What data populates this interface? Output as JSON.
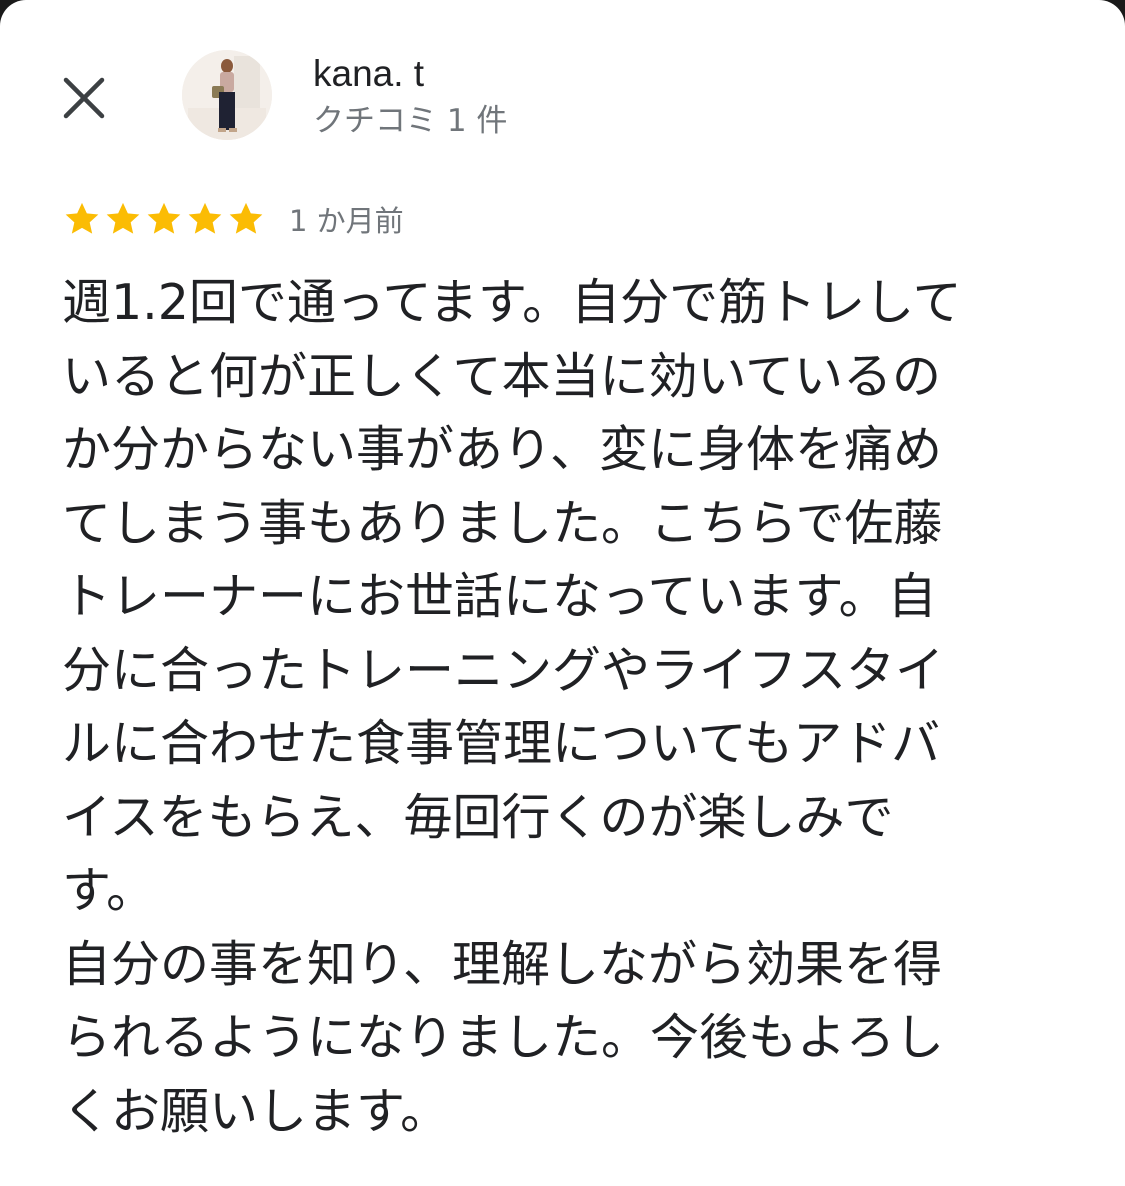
{
  "reviewer": {
    "name": "kana. t",
    "review_count": "クチコミ 1 件"
  },
  "review": {
    "rating": 5,
    "rating_max": 5,
    "date": "1 か月前",
    "lines": [
      "週1.2回で通ってます。自分で筋トレして",
      "いると何が正しくて本当に効いているの",
      "か分からない事があり、変に身体を痛め",
      "てしまう事もありました。こちらで佐藤",
      "トレーナーにお世話になっています。自",
      "分に合ったトレーニングやライフスタイ",
      "ルに合わせた食事管理についてもアドバ",
      "イスをもらえ、毎回行くのが楽しみで",
      "す。",
      "自分の事を知り、理解しながら効果を得",
      "られるようになりました。今後もよろし",
      "くお願いします。"
    ]
  },
  "icons": {
    "close": "close-icon",
    "star": "star-icon"
  },
  "colors": {
    "star": "#fbbc04",
    "text_primary": "#202124",
    "text_secondary": "#70757a",
    "background": "#ffffff"
  }
}
